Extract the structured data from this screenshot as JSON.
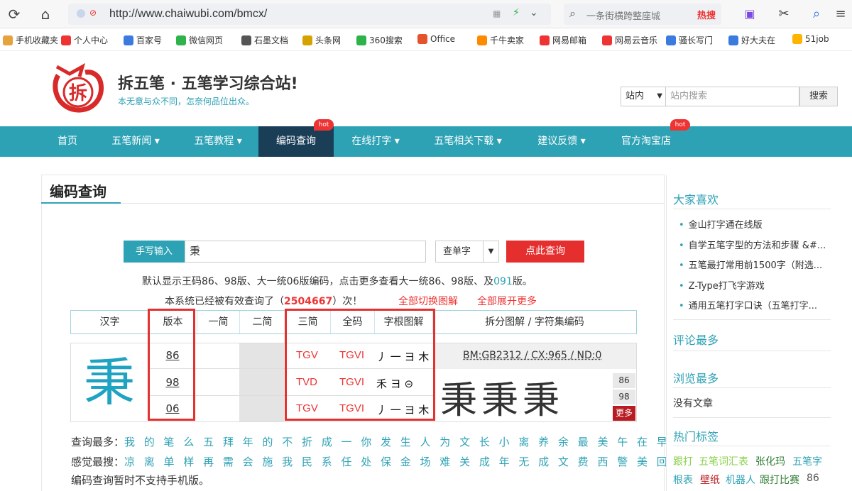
{
  "browser": {
    "url": "http://www.chaiwubi.com/bmcx/",
    "search_placeholder": "一条街横跨整座城",
    "search_hot": "热搜",
    "bookmarks": [
      {
        "label": "手机收藏夹",
        "color": "#e6a23c"
      },
      {
        "label": "个人中心",
        "color": "#e33"
      },
      {
        "label": "百家号",
        "color": "#3b7be0"
      },
      {
        "label": "微信网页",
        "color": "#2db34a"
      },
      {
        "label": "石墨文档",
        "color": "#555"
      },
      {
        "label": "头条网",
        "color": "#d4a300"
      },
      {
        "label": "360搜索",
        "color": "#2db34a"
      },
      {
        "label": "Office",
        "color": "#e5532d"
      },
      {
        "label": "千牛卖家",
        "color": "#ff8a00"
      },
      {
        "label": "网易邮箱",
        "color": "#e33"
      },
      {
        "label": "网易云音乐",
        "color": "#e33"
      },
      {
        "label": "骚长写门",
        "color": "#3b7be0"
      },
      {
        "label": "好大夫在",
        "color": "#3b7be0"
      },
      {
        "label": "51job",
        "color": "#ffb400"
      }
    ]
  },
  "header": {
    "logo_char": "拆",
    "title": "拆五笔 · 五笔学习综合站!",
    "slogan": "本无意与众不同，怎奈何品位出众。",
    "scope": "站内",
    "search_placeholder": "站内搜索",
    "search_button": "搜索"
  },
  "nav": {
    "items": [
      "首页",
      "五笔新闻 ▾",
      "五笔教程 ▾",
      "编码查询",
      "在线打字 ▾",
      "五笔相关下载 ▾",
      "建议反馈 ▾",
      "官方淘宝店"
    ],
    "badge": "hot"
  },
  "main": {
    "title": "编码查询",
    "handwrite_label": "手写输入",
    "input_value": "秉",
    "mode": "查单字",
    "query_button": "点此查询",
    "default_info": "默认显示王码86、98版、大一统06版编码，点击更多查看大一统86、98版、及",
    "default_info_link": "091",
    "default_info_end": "版。",
    "count_prefix": "本系统已经被有效查询了（",
    "count_value": "2504667",
    "count_suffix": "）次！",
    "switch_all": "全部切换图解",
    "expand_all": "全部展开更多",
    "headers": [
      "汉字",
      "版本",
      "一简",
      "二简",
      "三简",
      "全码",
      "字根图解",
      "拆分图解 / 字符集编码"
    ],
    "character": "秉",
    "rows": [
      {
        "version": "86",
        "jian3": "TGV",
        "full": "TGVI",
        "roots": "丿 一 ヨ 木"
      },
      {
        "version": "98",
        "jian3": "TVD",
        "full": "TGVI",
        "roots": "禾 ヨ ⊝"
      },
      {
        "version": "06",
        "jian3": "TGV",
        "full": "TGVI",
        "roots": "丿 一 ヨ 木"
      }
    ],
    "bm_info": "BM:GB2312 / CX:965 / ND:0",
    "glyphs": "秉秉秉",
    "side_tags": [
      "86",
      "98",
      "更多"
    ],
    "most_query_label": "查询最多：",
    "most_query": "我 的 笔 么 五 拜 年 的 不 折 成 一 你 发 生 人 为 文 长 小 离 养 余 最 美 午 在 早 民 好 心 中 国 喜 爱 谢",
    "recent_label": "感觉最搜：",
    "recent": "凉 离 单 样 再 需 会 施 我 民 系 任 处 保 金 场 难 关 成 年 无 成 文 费 西 警 美 回 心 么 解 几 上 改 声 以",
    "mobile_note": "编码查询暂时不支持手机版。"
  },
  "sidebar": {
    "likes_title": "大家喜欢",
    "likes": [
      "金山打字通在线版",
      "自学五笔字型的方法和步骤 &#...",
      "五笔最打常用前1500字（附选...",
      "Z-Type打飞字游戏",
      "通用五笔打字口诀（五笔打字..."
    ],
    "comments_title": "评论最多",
    "views_title": "浏览最多",
    "no_article": "没有文章",
    "tags_title": "热门标签",
    "tags": [
      {
        "text": "跟打",
        "color": "#8ad14a"
      },
      {
        "text": "五笔词汇表",
        "color": "#8ad14a"
      },
      {
        "text": "张化玛",
        "color": "#2e7d32"
      },
      {
        "text": "五笔字",
        "color": "#2ea2b5"
      },
      {
        "text": "根表",
        "color": "#2ea2b5"
      },
      {
        "text": "壁纸",
        "color": "#b81c22"
      },
      {
        "text": "机器人",
        "color": "#2ea2b5"
      },
      {
        "text": "跟打比赛",
        "color": "#2e7d32"
      },
      {
        "text": "86",
        "color": "#555"
      }
    ]
  }
}
